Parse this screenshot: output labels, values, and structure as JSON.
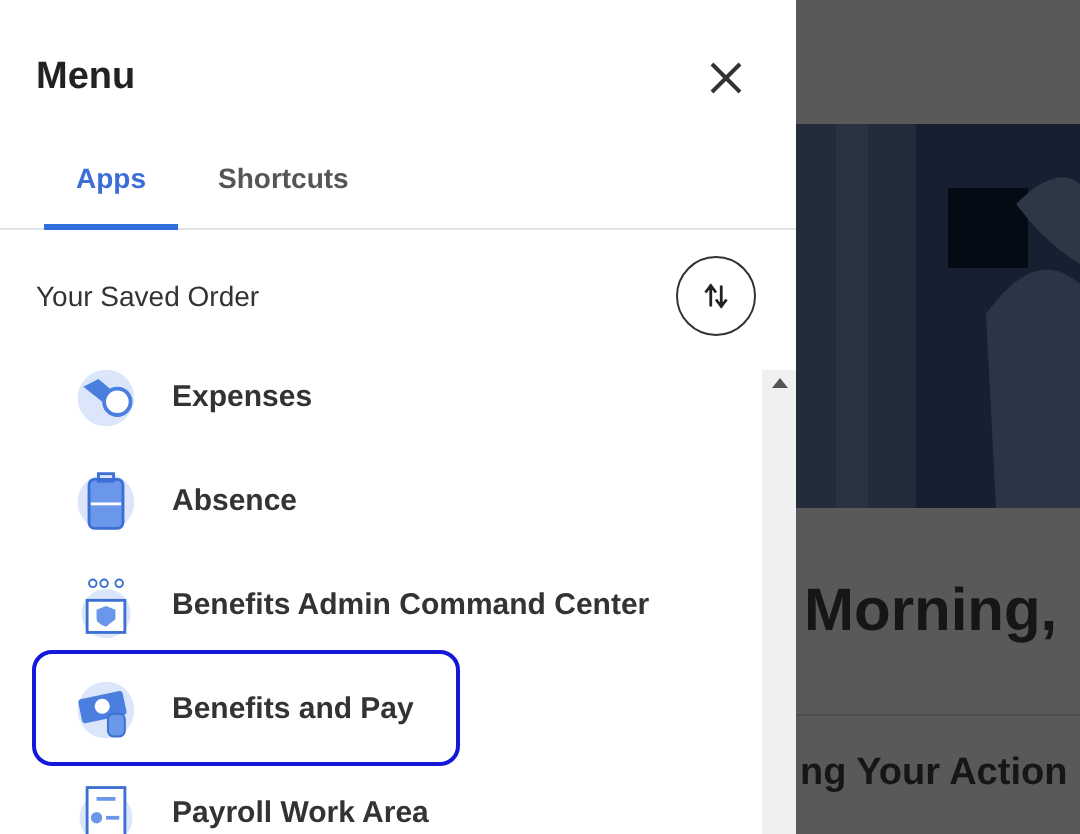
{
  "menu": {
    "title": "Menu",
    "tabs": [
      {
        "label": "Apps",
        "selected": true
      },
      {
        "label": "Shortcuts",
        "selected": false
      }
    ],
    "section_label": "Your Saved Order",
    "items": [
      {
        "label": "Expenses",
        "kind": "wallet",
        "highlighted": false
      },
      {
        "label": "Absence",
        "kind": "suitcase",
        "highlighted": false
      },
      {
        "label": "Benefits Admin Command Center",
        "kind": "box",
        "highlighted": false
      },
      {
        "label": "Benefits and Pay",
        "kind": "cash",
        "highlighted": true
      },
      {
        "label": "Payroll Work Area",
        "kind": "document",
        "highlighted": false
      }
    ]
  },
  "background": {
    "greeting": "Morning,",
    "section_heading": "ng Your Action"
  }
}
